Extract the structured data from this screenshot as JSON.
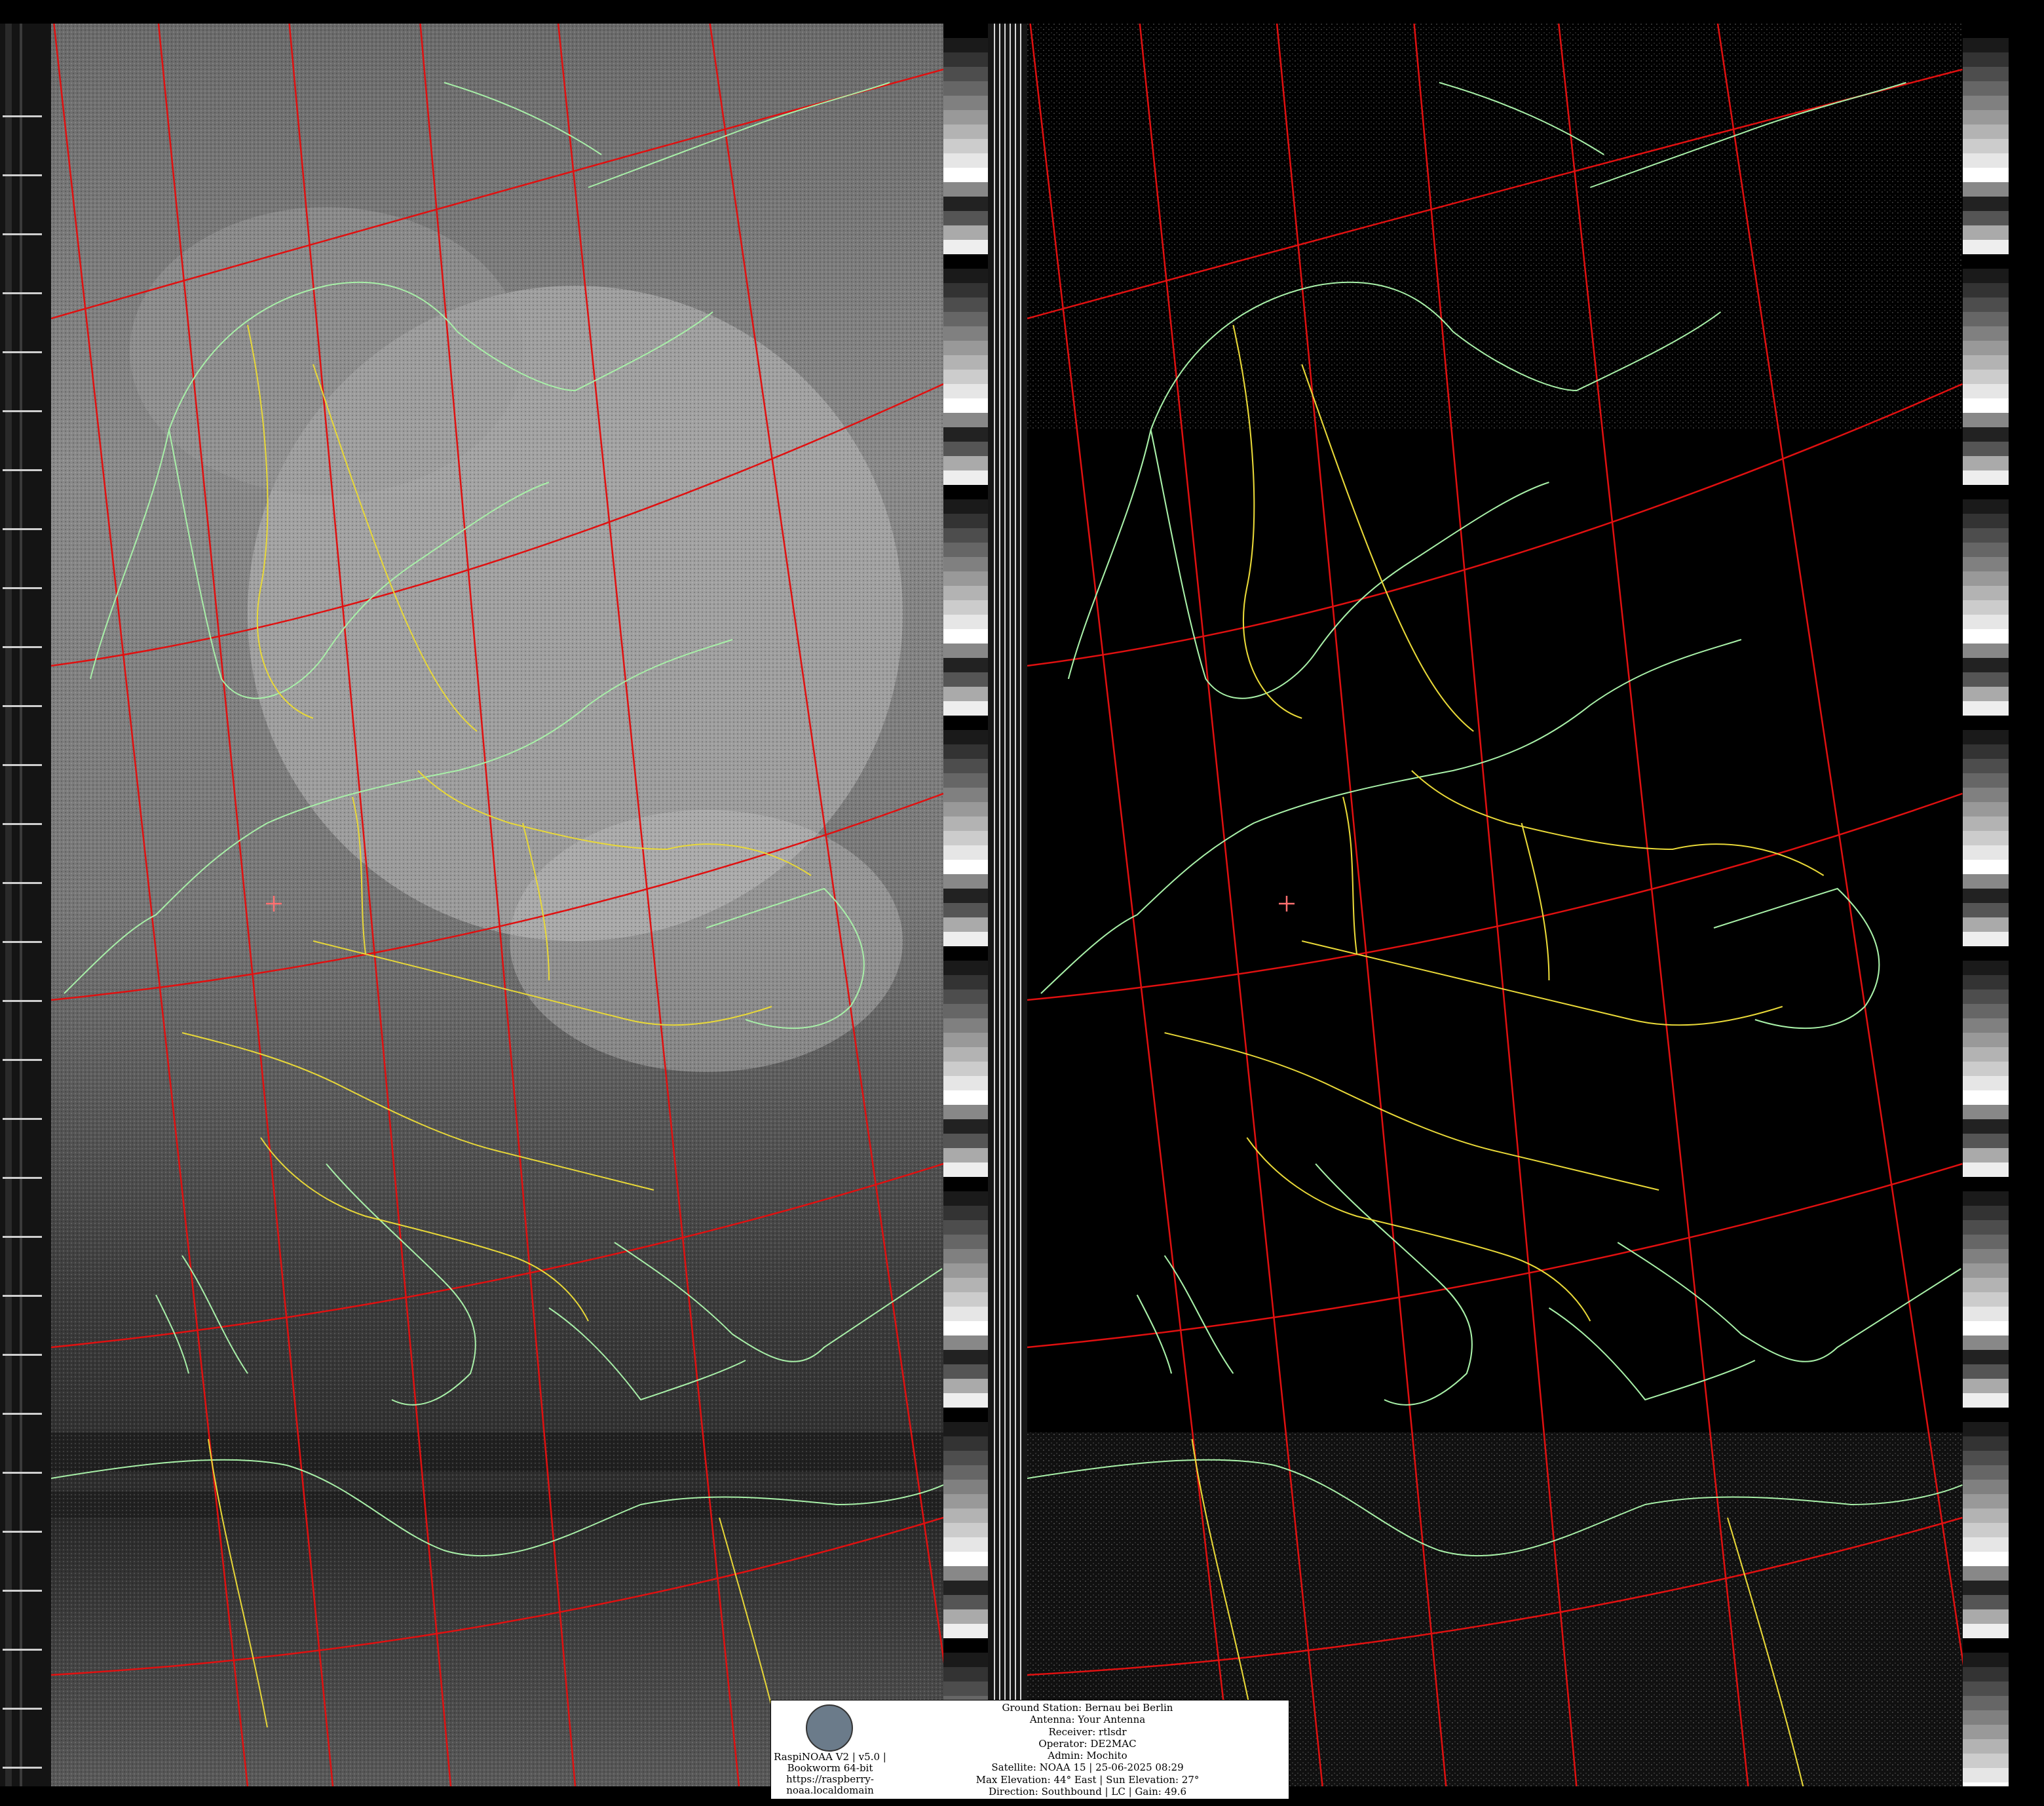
{
  "image": {
    "description_visible_text": true,
    "colors": {
      "grid_lines": "#e01010",
      "coastlines": "#a8f0a8",
      "borders": "#e8d838",
      "background": "#000000"
    }
  },
  "panels": {
    "left": {
      "kind": "visible-channel"
    },
    "right": {
      "kind": "infrared-channel"
    }
  },
  "info_box": {
    "version_lines": [
      "RaspiNOAA V2 | v5.0 |",
      "Bookworm 64-bit",
      "https://raspberry-",
      "noaa.localdomain"
    ],
    "station_lines": [
      "Ground Station: Bernau bei Berlin",
      "Antenna: Your Antenna",
      "Receiver: rtlsdr",
      "Operator: DE2MAC",
      "Admin: Mochito",
      "Satellite: NOAA 15 | 25-06-2025 08:29",
      "Max Elevation: 44° East | Sun Elevation: 27°",
      "Direction: Southbound | LC | Gain: 49.6"
    ]
  }
}
